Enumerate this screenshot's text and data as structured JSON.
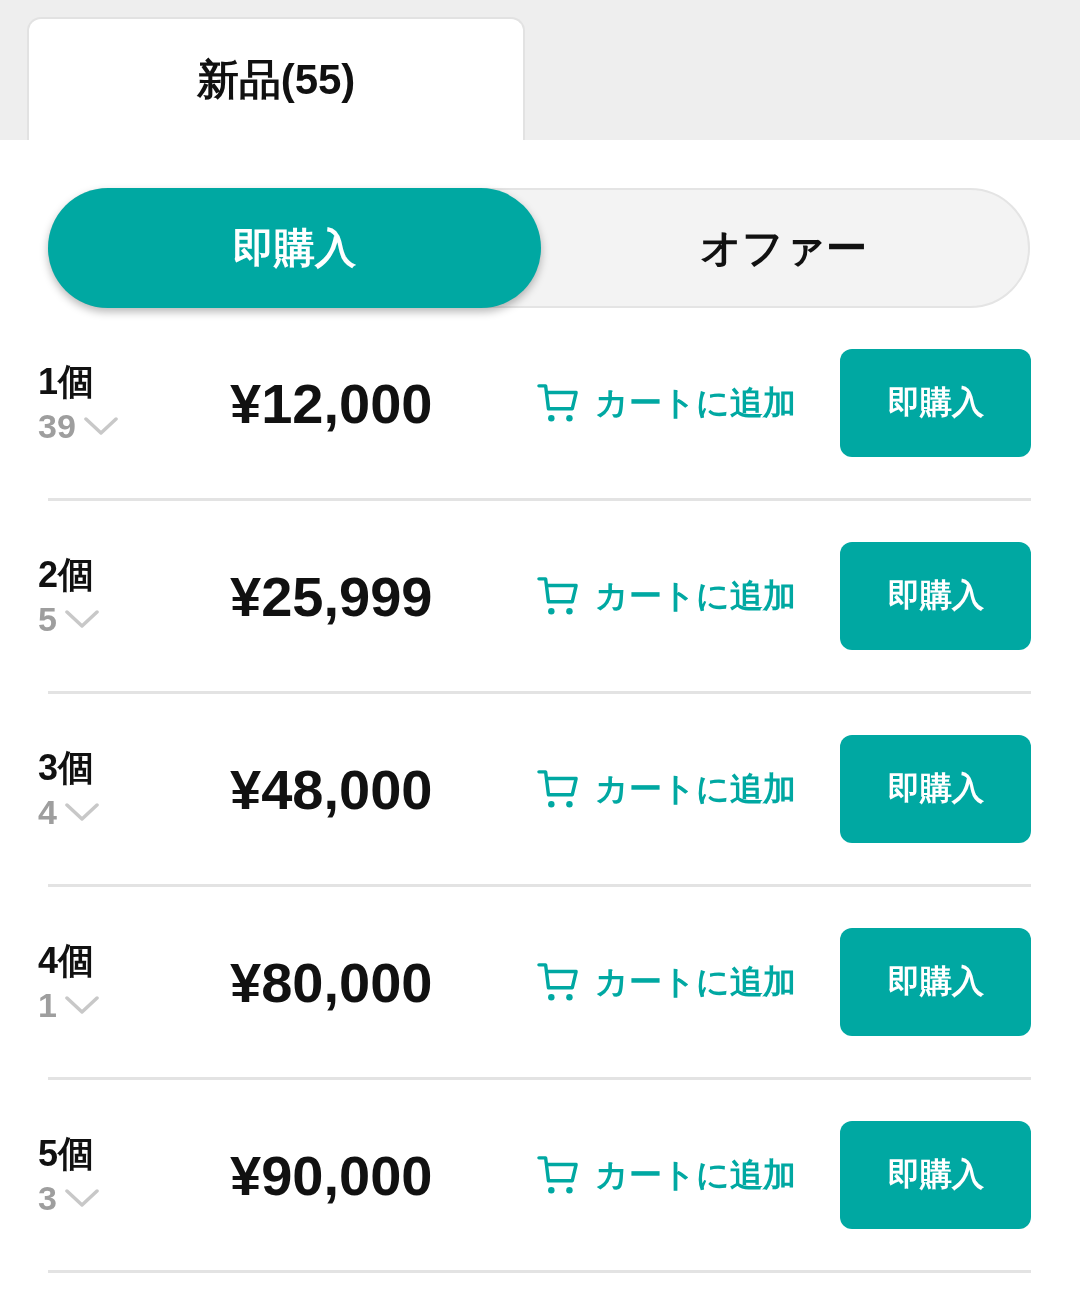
{
  "tabs": [
    {
      "label": "新品(55)",
      "selected": true
    }
  ],
  "mode_toggle": [
    {
      "label": "即購入",
      "selected": true
    },
    {
      "label": "オファー",
      "selected": false
    }
  ],
  "listings": [
    {
      "quantity": "1個",
      "count": "39",
      "price": "¥12,000",
      "cart_label": "カートに追加",
      "buy_label": "即購入"
    },
    {
      "quantity": "2個",
      "count": "5",
      "price": "¥25,999",
      "cart_label": "カートに追加",
      "buy_label": "即購入"
    },
    {
      "quantity": "3個",
      "count": "4",
      "price": "¥48,000",
      "cart_label": "カートに追加",
      "buy_label": "即購入"
    },
    {
      "quantity": "4個",
      "count": "1",
      "price": "¥80,000",
      "cart_label": "カートに追加",
      "buy_label": "即購入"
    },
    {
      "quantity": "5個",
      "count": "3",
      "price": "¥90,000",
      "cart_label": "カートに追加",
      "buy_label": "即購入"
    }
  ]
}
